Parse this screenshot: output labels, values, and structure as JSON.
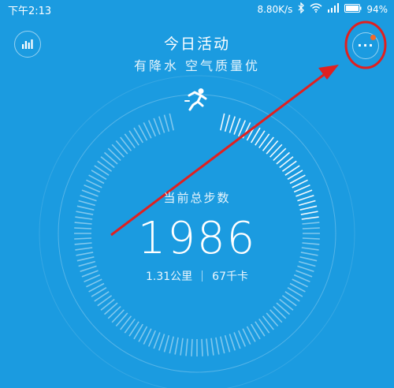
{
  "status_bar": {
    "time": "下午2:13",
    "network_speed": "8.80K/s",
    "battery": "94%",
    "icons": [
      "bluetooth-icon",
      "wifi-icon",
      "signal-icon",
      "battery-icon"
    ]
  },
  "header": {
    "title": "今日活动",
    "subtitle": "有降水 空气质量优"
  },
  "buttons": {
    "stats_icon": "bar-chart-icon",
    "more_icon": "more-dots-icon",
    "more_label": "···"
  },
  "activity": {
    "icon": "runner-icon",
    "total_label": "当前总步数",
    "steps": "1986",
    "distance": "1.31公里",
    "calories": "67千卡",
    "progress": 0.2
  },
  "colors": {
    "background": "#1b9be0",
    "accent_dot": "#f06a2a",
    "annotation": "#e02020"
  }
}
